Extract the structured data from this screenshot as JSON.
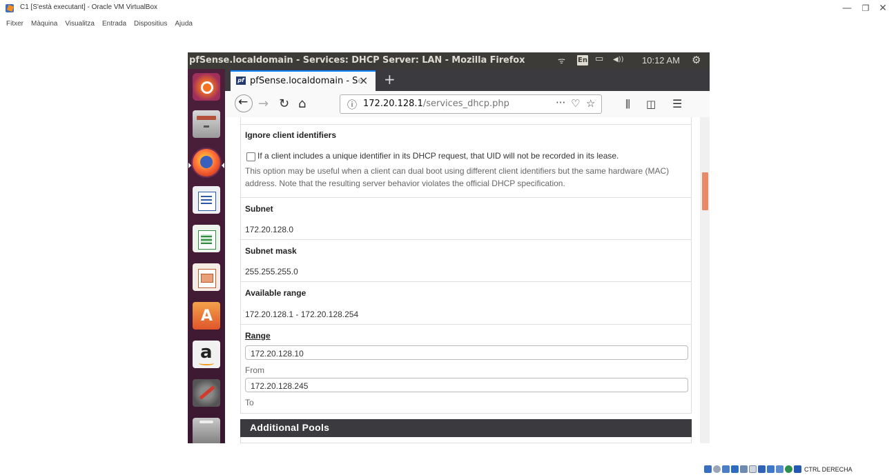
{
  "virtualbox": {
    "title": "C1 [S'està executant] - Oracle VM VirtualBox",
    "menu": [
      "Fitxer",
      "Màquina",
      "Visualitza",
      "Entrada",
      "Dispositius",
      "Ajuda"
    ],
    "host_key": "CTRL DERECHA",
    "window_controls": {
      "minimize": "—",
      "restore": "❐",
      "close": "✕"
    }
  },
  "ubuntu": {
    "window_title": "pfSense.localdomain - Services: DHCP Server: LAN - Mozilla Firefox",
    "keyboard_layout": "En",
    "clock": "10:12 AM",
    "indicators": {
      "wifi": "ᯤ",
      "battery": "▭",
      "volume": "◀))",
      "settings": "⚙"
    },
    "launcher_icons": [
      "ubuntu-dash-icon",
      "files-icon",
      "firefox-icon",
      "writer-icon",
      "calc-icon",
      "impress-icon",
      "software-center-icon",
      "amazon-icon",
      "system-settings-icon",
      "trash-icon"
    ]
  },
  "firefox": {
    "tab": {
      "favicon": "pf",
      "title": "pfSense.localdomain - S",
      "title_fade": "e",
      "close": "×"
    },
    "new_tab": "+",
    "nav": {
      "back": "←",
      "forward": "→",
      "reload": "↻",
      "home": "⌂",
      "more": "···",
      "pocket": "♡",
      "star": "☆",
      "library": "⫼",
      "sidebar": "◫",
      "menu": "☰",
      "info": "ⓘ"
    },
    "url": {
      "host": "172.20.128.1",
      "path": "/services_dhcp.php"
    }
  },
  "page": {
    "ignore_client_ids": {
      "label": "Ignore client identifiers",
      "checkbox_text": "If a client includes a unique identifier in its DHCP request, that UID will not be recorded in its lease.",
      "help": "This option may be useful when a client can dual boot using different client identifiers but the same hardware (MAC) address. Note that the resulting server behavior violates the official DHCP specification.",
      "checked": false
    },
    "subnet": {
      "label": "Subnet",
      "value": "172.20.128.0"
    },
    "subnet_mask": {
      "label": "Subnet mask",
      "value": "255.255.255.0"
    },
    "available_range": {
      "label": "Available range",
      "value": "172.20.128.1 - 172.20.128.254"
    },
    "range": {
      "label": "Range",
      "from_value": "172.20.128.10",
      "from_label": "From",
      "to_value": "172.20.128.245",
      "to_label": "To"
    },
    "additional_pools": {
      "title": "Additional Pools"
    }
  },
  "colors": {
    "launcher": "#4d1f3a",
    "topbar": "#3c3b37",
    "tabstrip": "#3b3b3f",
    "accent_scroll": "#e8896a",
    "tab_accent": "#0a84ff"
  }
}
